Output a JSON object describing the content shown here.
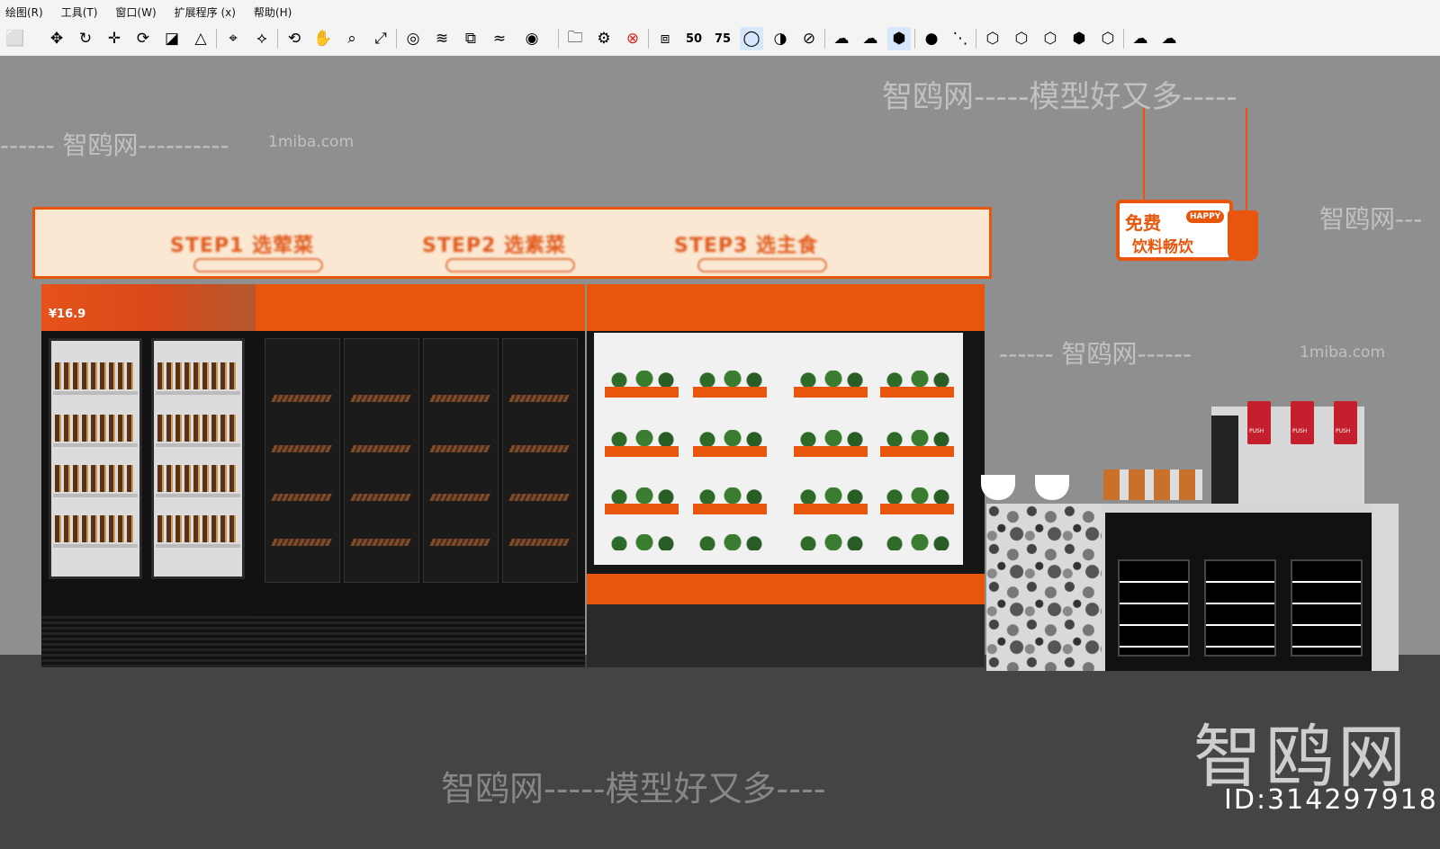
{
  "app": {
    "menus": [
      "绘图(R)",
      "工具(T)",
      "窗口(W)",
      "扩展程序 (x)",
      "帮助(H)"
    ]
  },
  "toolbar": {
    "icons": [
      "select-icon",
      "move-icon",
      "rotate-icon",
      "scale-icon",
      "pushpull-icon",
      "offset-icon",
      "tape-measure-icon",
      "protractor-icon",
      "paint-icon",
      "orbit-icon",
      "pan-icon",
      "zoom-icon",
      "zoom-extents-icon",
      "sandbox-icon",
      "contour-icon",
      "stamp-icon",
      "drape-icon",
      "user-icon",
      "folder-icon",
      "gear-icon",
      "close-icon",
      "layers-icon",
      "sec50-icon",
      "sec75-icon",
      "drop-icon",
      "contrast-icon",
      "hatch-icon",
      "cloud-x-icon",
      "cloud-download-icon",
      "cube-icon",
      "dot-icon",
      "line-icon",
      "iso-1-icon",
      "iso-2-icon",
      "iso-3-icon",
      "iso-4-icon",
      "iso-5-icon",
      "cloud-1-icon",
      "cloud-2-icon"
    ],
    "active_icon": "cube-icon"
  },
  "viewport": {
    "watermarks": {
      "top_right": "智鸥网-----模型好又多-----",
      "top_left": "------ 智鸥网----------",
      "url_left": "1miba.com",
      "mid_right_1": "1miba.com",
      "mid_right_2": "------ 智鸥网------",
      "mid_right_url": "1miba.com",
      "right_small": "智鸥网---",
      "big_logo": "智鸥网",
      "bottom_center": "智鸥网-----模型好又多----",
      "fridge_wm": "智鸥网",
      "fridge_url": "1miba.com"
    },
    "id_text": "ID:314297918"
  },
  "scene": {
    "signboard": {
      "steps": [
        "STEP1 选荤菜",
        "STEP2 选素菜",
        "STEP3 选主食"
      ]
    },
    "promo": {
      "price": "¥16.9"
    },
    "hanging_sign": {
      "line1": "免费",
      "line2": "饮料畅饮",
      "badge": "HAPPY"
    },
    "machine": {
      "labels": [
        "PUSH",
        "PUSH",
        "PUSH"
      ]
    }
  }
}
